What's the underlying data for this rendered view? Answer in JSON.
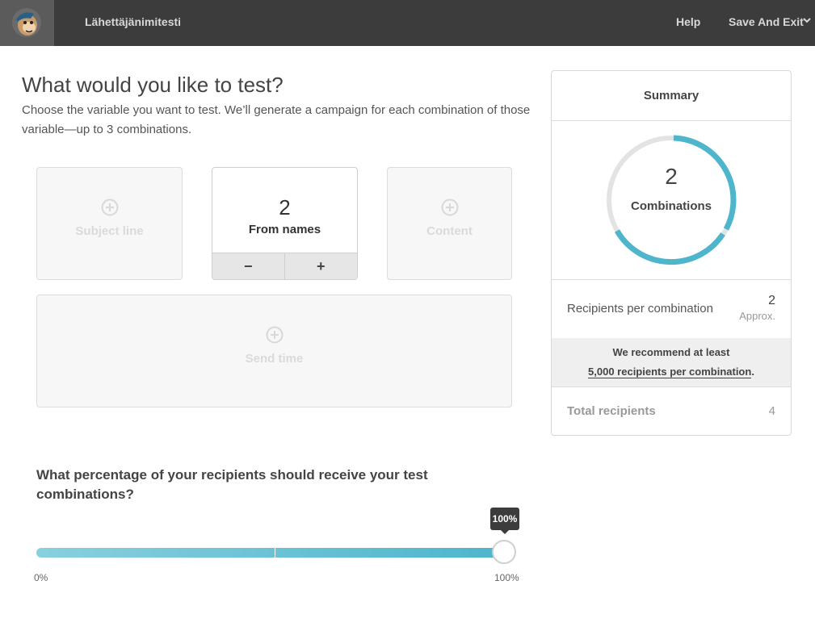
{
  "header": {
    "app_title": "Lähettäjänimitesti",
    "help_label": "Help",
    "save_exit_label": "Save And Exit"
  },
  "main": {
    "title": "What would you like to test?",
    "description": "Choose the variable you want to test. We’ll generate a campaign for each combination of those variable—up to 3 combinations."
  },
  "variables": {
    "subject_line": "Subject line",
    "from_names": {
      "count": "2",
      "label": "From names",
      "minus": "−",
      "plus": "+"
    },
    "content": "Content",
    "send_time": "Send time"
  },
  "percentage": {
    "question": "What percentage of your recipients should receive your test combinations?",
    "value": 100,
    "tooltip": "100%",
    "min_label": "0%",
    "max_label": "100%"
  },
  "summary": {
    "title": "Summary",
    "combinations_count": "2",
    "combinations_label": "Combinations",
    "recipients_per_combination_label": "Recipients per combination",
    "recipients_per_combination_value": "2",
    "approx_label": "Approx.",
    "recommend_text": "We recommend at least",
    "recommend_link": "5,000 recipients per combination",
    "recommend_suffix": ".",
    "total_recipients_label": "Total recipients",
    "total_recipients_value": "4"
  },
  "colors": {
    "topbar": "#3c3c3c",
    "accent": "#4eb5cc",
    "ring_track": "#e3e3e3"
  }
}
